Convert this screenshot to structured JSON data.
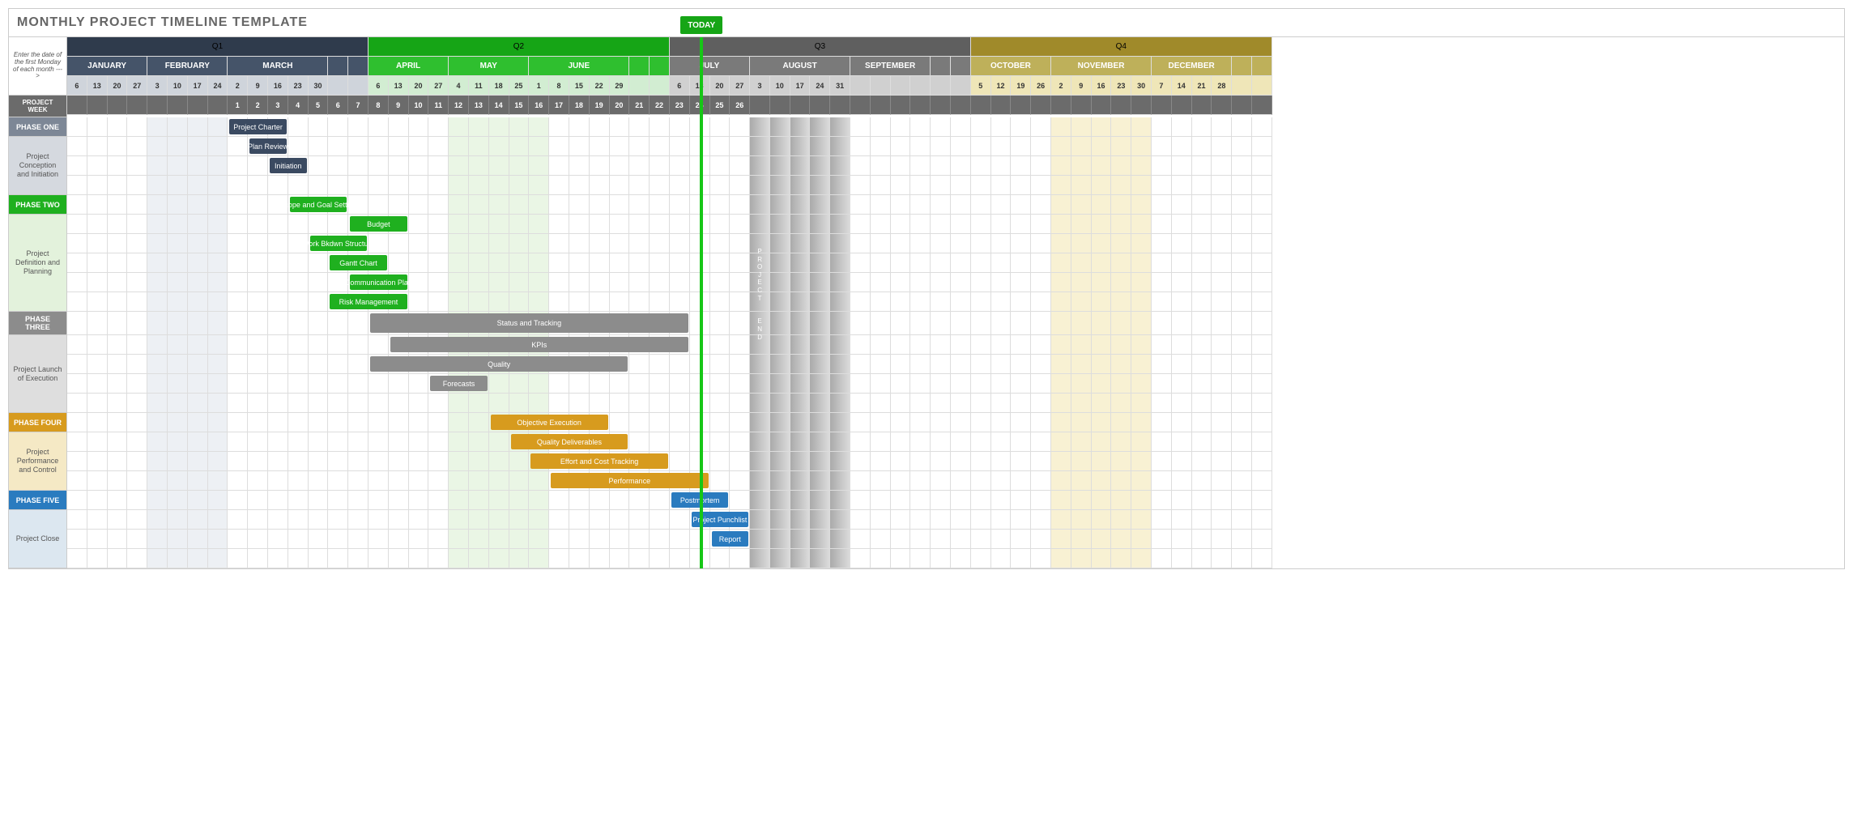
{
  "title": "MONTHLY PROJECT TIMELINE TEMPLATE",
  "side_note": "Enter the date of the first Monday of each month --->",
  "today_label": "TODAY",
  "project_week_label": "PROJECT WEEK",
  "project_end_label": "PROJECT END",
  "quarters": [
    {
      "name": "Q1",
      "cols": 15,
      "cls": "q1",
      "months": [
        {
          "name": "JANUARY",
          "days": [
            6,
            13,
            20,
            27
          ]
        },
        {
          "name": "FEBRUARY",
          "days": [
            3,
            10,
            17,
            24
          ]
        },
        {
          "name": "MARCH",
          "days": [
            2,
            9,
            16,
            23,
            30
          ]
        },
        {
          "name": "",
          "days": [
            ""
          ]
        },
        {
          "name": "",
          "days": [
            ""
          ]
        }
      ]
    },
    {
      "name": "Q2",
      "cols": 15,
      "cls": "q2",
      "months": [
        {
          "name": "APRIL",
          "days": [
            6,
            13,
            20,
            27
          ]
        },
        {
          "name": "MAY",
          "days": [
            4,
            11,
            18,
            25
          ]
        },
        {
          "name": "JUNE",
          "days": [
            1,
            8,
            15,
            22,
            29
          ]
        },
        {
          "name": "",
          "days": [
            ""
          ]
        },
        {
          "name": "",
          "days": [
            ""
          ]
        }
      ]
    },
    {
      "name": "Q3",
      "cols": 15,
      "cls": "q3",
      "months": [
        {
          "name": "JULY",
          "days": [
            6,
            13,
            20,
            27
          ]
        },
        {
          "name": "AUGUST",
          "days": [
            3,
            10,
            17,
            24,
            31
          ]
        },
        {
          "name": "SEPTEMBER",
          "days": [
            "",
            "",
            "",
            ""
          ]
        },
        {
          "name": "",
          "days": [
            ""
          ]
        },
        {
          "name": "",
          "days": [
            ""
          ]
        }
      ]
    },
    {
      "name": "Q4",
      "cols": 15,
      "cls": "q4",
      "months": [
        {
          "name": "OCTOBER",
          "days": [
            5,
            12,
            19,
            26
          ]
        },
        {
          "name": "NOVEMBER",
          "days": [
            2,
            9,
            16,
            23,
            30
          ]
        },
        {
          "name": "DECEMBER",
          "days": [
            7,
            14,
            21,
            28
          ]
        },
        {
          "name": "",
          "days": [
            ""
          ]
        },
        {
          "name": "",
          "days": [
            ""
          ]
        }
      ]
    }
  ],
  "project_weeks_start": 9,
  "project_weeks": [
    1,
    2,
    3,
    4,
    5,
    6,
    7,
    8,
    9,
    10,
    11,
    12,
    13,
    14,
    15,
    16,
    17,
    18,
    19,
    20,
    21,
    22,
    23,
    24,
    25,
    26
  ],
  "today_col": 32,
  "project_end_col": 35,
  "shade_ranges": [
    {
      "start": 5,
      "len": 4,
      "cls": "shade-q1"
    },
    {
      "start": 20,
      "len": 5,
      "cls": "shade-q2"
    },
    {
      "start": 35,
      "len": 5,
      "cls": "shade-q3"
    },
    {
      "start": 50,
      "len": 5,
      "cls": "shade-q4"
    }
  ],
  "phases": [
    {
      "header": "PHASE ONE",
      "hcls": "ph1",
      "lcls": "lbl1",
      "label": "Project Conception and Initiation",
      "rows": [
        {
          "bar": {
            "start": 9,
            "len": 3,
            "text": "Project Charter",
            "cls": "ph1b"
          }
        },
        {
          "bar": {
            "start": 10,
            "len": 2,
            "text": "Plan Review",
            "cls": "ph1b"
          }
        },
        {
          "bar": {
            "start": 11,
            "len": 2,
            "text": "Initiation",
            "cls": "ph1b"
          }
        }
      ],
      "tail": 1
    },
    {
      "header": "PHASE TWO",
      "hcls": "ph2",
      "lcls": "lbl2",
      "label": "Project Definition and Planning",
      "rows": [
        {
          "bar": {
            "start": 12,
            "len": 3,
            "text": "Scope and Goal Setting",
            "cls": "ph2b"
          }
        },
        {
          "bar": {
            "start": 15,
            "len": 3,
            "text": "Budget",
            "cls": "ph2b"
          }
        },
        {
          "bar": {
            "start": 13,
            "len": 3,
            "text": "Work Bkdwn Structure",
            "cls": "ph2b"
          }
        },
        {
          "bar": {
            "start": 14,
            "len": 3,
            "text": "Gantt Chart",
            "cls": "ph2b"
          }
        },
        {
          "bar": {
            "start": 15,
            "len": 3,
            "text": "Communication Plan",
            "cls": "ph2b"
          }
        },
        {
          "bar": {
            "start": 14,
            "len": 4,
            "text": "Risk Management",
            "cls": "ph2b"
          }
        }
      ],
      "tail": 0
    },
    {
      "header": "PHASE THREE",
      "hcls": "ph3",
      "lcls": "lbl3",
      "label": "Project Launch of Execution",
      "rows": [
        {
          "bar": {
            "start": 16,
            "len": 16,
            "text": "Status  and Tracking",
            "cls": "ph3b"
          }
        },
        {
          "bar": {
            "start": 17,
            "len": 15,
            "text": "KPIs",
            "cls": "ph3b"
          }
        },
        {
          "bar": {
            "start": 16,
            "len": 13,
            "text": "Quality",
            "cls": "ph3b"
          }
        },
        {
          "bar": {
            "start": 19,
            "len": 3,
            "text": "Forecasts",
            "cls": "ph3b"
          }
        }
      ],
      "tail": 1
    },
    {
      "header": "PHASE FOUR",
      "hcls": "ph4",
      "lcls": "lbl4",
      "label": "Project Performance and Control",
      "rows": [
        {
          "bar": {
            "start": 22,
            "len": 6,
            "text": "Objective Execution",
            "cls": "ph4b"
          }
        },
        {
          "bar": {
            "start": 23,
            "len": 6,
            "text": "Quality Deliverables",
            "cls": "ph4b"
          }
        },
        {
          "bar": {
            "start": 24,
            "len": 7,
            "text": "Effort and Cost Tracking",
            "cls": "ph4b"
          }
        },
        {
          "bar": {
            "start": 25,
            "len": 8,
            "text": "Performance",
            "cls": "ph4b"
          }
        }
      ],
      "tail": 0
    },
    {
      "header": "PHASE FIVE",
      "hcls": "ph5",
      "lcls": "lbl5",
      "label": "Project Close",
      "rows": [
        {
          "bar": {
            "start": 31,
            "len": 3,
            "text": "Postmortem",
            "cls": "ph5b"
          }
        },
        {
          "bar": {
            "start": 32,
            "len": 3,
            "text": "Project Punchlist",
            "cls": "ph5b"
          }
        },
        {
          "bar": {
            "start": 33,
            "len": 2,
            "text": "Report",
            "cls": "ph5b"
          }
        }
      ],
      "tail": 1
    }
  ],
  "chart_data": {
    "type": "gantt",
    "title": "Monthly Project Timeline Template",
    "time_unit": "project-week",
    "x_range": [
      1,
      26
    ],
    "today_marker_week": 23,
    "project_end_week": 26,
    "phases": [
      {
        "name": "Phase One",
        "group": "Project Conception and Initiation",
        "tasks": [
          {
            "name": "Project Charter",
            "start_week": 1,
            "duration_weeks": 3
          },
          {
            "name": "Plan Review",
            "start_week": 2,
            "duration_weeks": 2
          },
          {
            "name": "Initiation",
            "start_week": 3,
            "duration_weeks": 2
          }
        ]
      },
      {
        "name": "Phase Two",
        "group": "Project Definition and Planning",
        "tasks": [
          {
            "name": "Scope and Goal Setting",
            "start_week": 4,
            "duration_weeks": 3
          },
          {
            "name": "Budget",
            "start_week": 7,
            "duration_weeks": 3
          },
          {
            "name": "Work Bkdwn Structure",
            "start_week": 5,
            "duration_weeks": 3
          },
          {
            "name": "Gantt Chart",
            "start_week": 6,
            "duration_weeks": 3
          },
          {
            "name": "Communication Plan",
            "start_week": 7,
            "duration_weeks": 3
          },
          {
            "name": "Risk Management",
            "start_week": 6,
            "duration_weeks": 4
          }
        ]
      },
      {
        "name": "Phase Three",
        "group": "Project Launch of Execution",
        "tasks": [
          {
            "name": "Status and Tracking",
            "start_week": 8,
            "duration_weeks": 16
          },
          {
            "name": "KPIs",
            "start_week": 9,
            "duration_weeks": 15
          },
          {
            "name": "Quality",
            "start_week": 8,
            "duration_weeks": 13
          },
          {
            "name": "Forecasts",
            "start_week": 11,
            "duration_weeks": 3
          }
        ]
      },
      {
        "name": "Phase Four",
        "group": "Project Performance and Control",
        "tasks": [
          {
            "name": "Objective Execution",
            "start_week": 14,
            "duration_weeks": 6
          },
          {
            "name": "Quality Deliverables",
            "start_week": 15,
            "duration_weeks": 6
          },
          {
            "name": "Effort and Cost Tracking",
            "start_week": 16,
            "duration_weeks": 7
          },
          {
            "name": "Performance",
            "start_week": 17,
            "duration_weeks": 8
          }
        ]
      },
      {
        "name": "Phase Five",
        "group": "Project Close",
        "tasks": [
          {
            "name": "Postmortem",
            "start_week": 23,
            "duration_weeks": 3
          },
          {
            "name": "Project Punchlist",
            "start_week": 24,
            "duration_weeks": 3
          },
          {
            "name": "Report",
            "start_week": 25,
            "duration_weeks": 2
          }
        ]
      }
    ]
  }
}
